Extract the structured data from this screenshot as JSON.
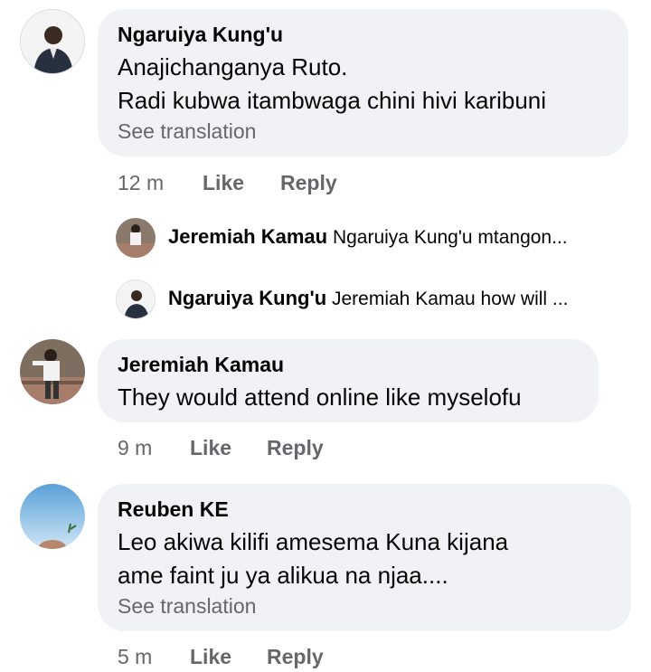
{
  "comments": [
    {
      "author": "Ngaruiya Kung'u",
      "lines": [
        "Anajichanganya Ruto.",
        "Radi kubwa itambwaga chini hivi karibuni"
      ],
      "see_translation": "See translation",
      "time": "12 m",
      "like": "Like",
      "reply": "Reply"
    },
    {
      "author": "Jeremiah Kamau",
      "lines": [
        "They would attend online like myselofu"
      ],
      "time": "9 m",
      "like": "Like",
      "reply": "Reply"
    },
    {
      "author": "Reuben KE",
      "lines": [
        "Leo akiwa kilifi amesema Kuna kijana",
        "ame faint ju ya alikua na njaa...."
      ],
      "see_translation": "See translation",
      "time": "5 m",
      "like": "Like",
      "reply": "Reply"
    }
  ],
  "replies": [
    {
      "author": "Jeremiah Kamau",
      "preview": "Ngaruiya Kung'u mtangon..."
    },
    {
      "author": "Ngaruiya Kung'u",
      "preview": "Jeremiah Kamau how will ..."
    }
  ],
  "colors": {
    "bubble": "#f0f2f5",
    "secondary_text": "#65676b",
    "primary_text": "#050505"
  }
}
